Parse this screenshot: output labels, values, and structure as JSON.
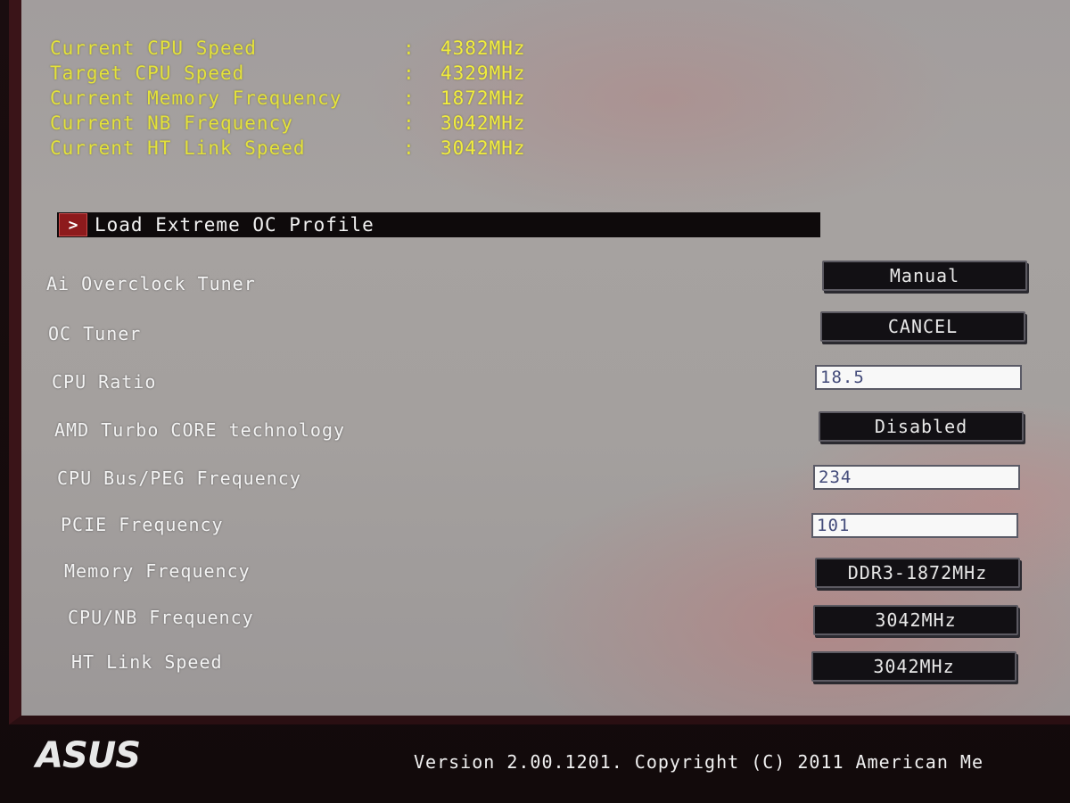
{
  "info": [
    {
      "label": "Current CPU Speed",
      "value": "4382MHz"
    },
    {
      "label": "Target CPU Speed",
      "value": "4329MHz"
    },
    {
      "label": "Current Memory Frequency",
      "value": "1872MHz"
    },
    {
      "label": "Current NB Frequency",
      "value": "3042MHz"
    },
    {
      "label": "Current HT Link Speed",
      "value": "3042MHz"
    }
  ],
  "separator": ":",
  "profile": {
    "arrow": ">",
    "label": "Load Extreme OC Profile"
  },
  "settings": [
    {
      "label": "Ai Overclock Tuner",
      "value": "Manual"
    },
    {
      "label": "OC Tuner",
      "value": "CANCEL"
    },
    {
      "label": "CPU Ratio",
      "value": "18.5"
    },
    {
      "label": "AMD Turbo CORE technology",
      "value": "Disabled"
    },
    {
      "label": "CPU Bus/PEG Frequency",
      "value": "234"
    },
    {
      "label": "PCIE Frequency",
      "value": "101"
    },
    {
      "label": "Memory Frequency",
      "value": "DDR3-1872MHz"
    },
    {
      "label": "CPU/NB Frequency",
      "value": "3042MHz"
    },
    {
      "label": "HT Link Speed",
      "value": "3042MHz"
    }
  ],
  "footer": {
    "logo": "ASUS",
    "version": "Version 2.00.1201. Copyright (C) 2011 American Me"
  },
  "colors": {
    "info_text": "#e4e23a",
    "selection_bar": "#0e0a0b",
    "selection_arrow": "#8d1a1c",
    "button_bg": "#121014",
    "field_text": "#434b7a"
  }
}
